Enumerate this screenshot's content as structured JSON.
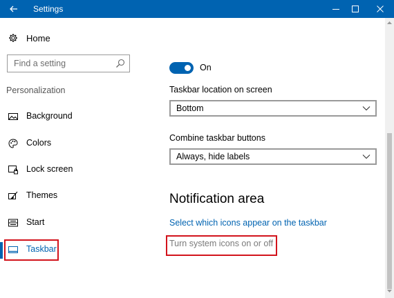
{
  "window": {
    "title": "Settings",
    "back_icon": "back-arrow-icon",
    "controls": [
      "minimize-icon",
      "maximize-icon",
      "close-icon"
    ],
    "accent_color": "#0063b1"
  },
  "nav": {
    "home_label": "Home",
    "search_placeholder": "Find a setting",
    "section_label": "Personalization",
    "items": [
      {
        "label": "Background",
        "icon": "picture-icon"
      },
      {
        "label": "Colors",
        "icon": "palette-icon"
      },
      {
        "label": "Lock screen",
        "icon": "lock-screen-icon"
      },
      {
        "label": "Themes",
        "icon": "themes-brush-icon"
      },
      {
        "label": "Start",
        "icon": "start-menu-icon"
      },
      {
        "label": "Taskbar",
        "icon": "taskbar-icon",
        "active": true
      }
    ]
  },
  "main": {
    "toggle_label": "On",
    "toggle_state": true,
    "location_label": "Taskbar location on screen",
    "location_value": "Bottom",
    "combine_label": "Combine taskbar buttons",
    "combine_value": "Always, hide labels",
    "notification_heading": "Notification area",
    "link_select_icons": "Select which icons appear on the taskbar",
    "link_system_icons": "Turn system icons on or off"
  },
  "annotation_color": "#d2121b"
}
